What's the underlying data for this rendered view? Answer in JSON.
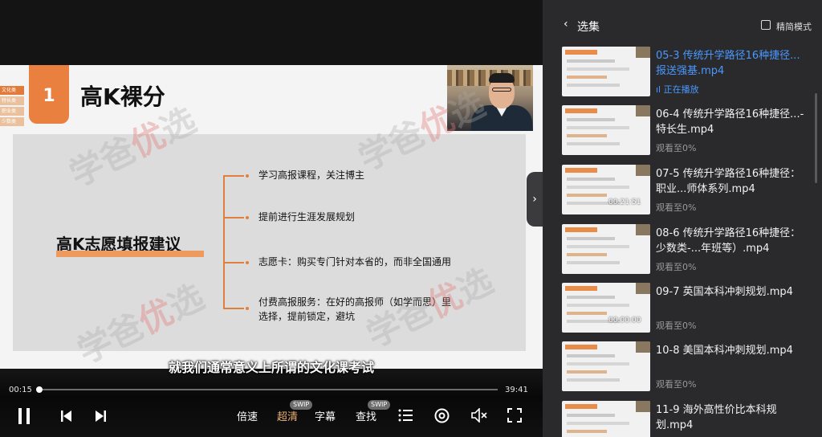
{
  "slide": {
    "tabs": [
      "文化类",
      "特长类",
      "职业类",
      "少数类"
    ],
    "number": "1",
    "title": "高K裸分",
    "mind_title": "高K志愿填报建议",
    "branches": [
      "学习高报课程，关注博主",
      "提前进行生涯发展规划",
      "志愿卡：购买专门针对本省的，而非全国通用",
      "付费高报服务：在好的高报师（如学而思）里",
      "选择，提前锁定，避坑"
    ],
    "watermark": {
      "a": "学爸",
      "b": "优",
      "c": "选"
    }
  },
  "subtitle": "就我们通常意义上所谓的文化课考试",
  "player": {
    "current_time": "00:15",
    "total_time": "39:41",
    "progress": 0.006,
    "speed_label": "倍速",
    "quality_label": "超清",
    "quality_badge": "SWIP",
    "caption_label": "字幕",
    "search_label": "查找",
    "search_badge": "SWIP"
  },
  "sidebar": {
    "title": "选集",
    "mode_label": "精简模式",
    "episodes": [
      {
        "title": "05-3 传统升学路径16种捷径... 报送强基.mp4",
        "status": "正在播放",
        "active": true
      },
      {
        "title": "06-4 传统升学路径16种捷径...- 特长生.mp4",
        "status": "观看至0%",
        "active": false
      },
      {
        "title": "07-5 传统升学路径16种捷径：职业...师体系列.mp4",
        "status": "观看至0%",
        "active": false,
        "thumb_time": "00:21:51"
      },
      {
        "title": "08-6 传统升学路径16种捷径：少数类-...年班等）.mp4",
        "status": "观看至0%",
        "active": false
      },
      {
        "title": "09-7 英国本科冲刺规划.mp4",
        "status": "观看至0%",
        "active": false,
        "thumb_time": "00:00:00"
      },
      {
        "title": "10-8 美国本科冲刺规划.mp4",
        "status": "观看至0%",
        "active": false
      },
      {
        "title": "11-9 海外高性价比本科规划.mp4",
        "status": "",
        "active": false
      }
    ]
  },
  "colors": {
    "accent_orange": "#e9803f",
    "active_blue": "#4a98ff",
    "quality_gold": "#e6ae72"
  }
}
